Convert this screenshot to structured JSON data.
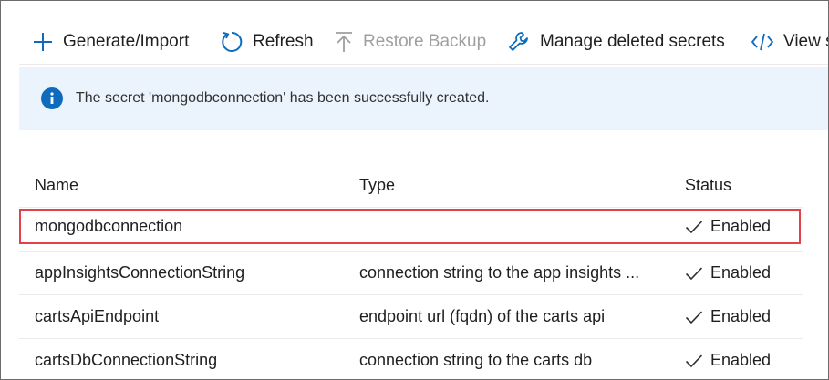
{
  "toolbar": {
    "items": [
      {
        "label": "Generate/Import",
        "icon": "plus-icon",
        "enabled": true
      },
      {
        "label": "Refresh",
        "icon": "refresh-icon",
        "enabled": true
      },
      {
        "label": "Restore Backup",
        "icon": "upload-arrow-icon",
        "enabled": false
      },
      {
        "label": "Manage deleted secrets",
        "icon": "wrench-icon",
        "enabled": true
      },
      {
        "label": "View s",
        "icon": "code-icon",
        "enabled": true
      }
    ]
  },
  "banner": {
    "icon": "info-icon",
    "message": "The secret 'mongodbconnection' has been successfully created."
  },
  "table": {
    "columns": {
      "name": "Name",
      "type": "Type",
      "status": "Status"
    },
    "rows": [
      {
        "name": "mongodbconnection",
        "type": "",
        "status": "Enabled",
        "highlighted": true
      },
      {
        "name": "appInsightsConnectionString",
        "type": "connection string to the app insights ...",
        "status": "Enabled",
        "highlighted": false
      },
      {
        "name": "cartsApiEndpoint",
        "type": "endpoint url (fqdn) of the carts api",
        "status": "Enabled",
        "highlighted": false
      },
      {
        "name": "cartsDbConnectionString",
        "type": "connection string to the carts db",
        "status": "Enabled",
        "highlighted": false
      }
    ]
  },
  "colors": {
    "accent": "#0f6cbd",
    "banner_bg": "#ebf3fc",
    "highlight": "#e0414a",
    "disabled": "#a19f9d"
  }
}
